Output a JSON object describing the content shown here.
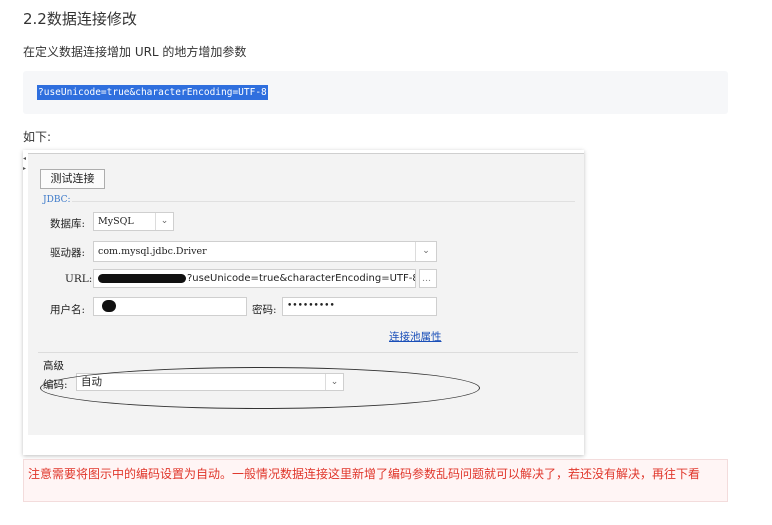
{
  "heading": "2.2数据连接修改",
  "intro": "在定义数据连接增加 URL 的地方增加参数",
  "code": "?useUnicode=true&characterEncoding=UTF-8",
  "below_label": "如下:",
  "dialog": {
    "test_button": "测试连接",
    "jdbc_label": "JDBC:",
    "db_label": "数据库:",
    "db_value": "MySQL",
    "driver_label": "驱动器:",
    "driver_value": "com.mysql.jdbc.Driver",
    "url_label": "URL:",
    "url_value": "?useUnicode=true&characterEncoding=UTF-8",
    "url_more": "...",
    "user_label": "用户名:",
    "password_label": "密码:",
    "password_value": "•••••••••",
    "pool_link": "连接池属性",
    "advanced_label": "高级",
    "encoding_label": "编码:",
    "encoding_value": "自动"
  },
  "note": "注意需要将图示中的编码设置为自动。一般情况数据连接这里新增了编码参数乱码问题就可以解决了，若还没有解决，再往下看",
  "colors": {
    "code_bg": "#2f6fde",
    "note_text": "#e0362b",
    "note_bg": "#fff5f5",
    "link": "#1a4fb8"
  },
  "icons": [
    "chevron-down-icon",
    "side-arrow-icon"
  ]
}
